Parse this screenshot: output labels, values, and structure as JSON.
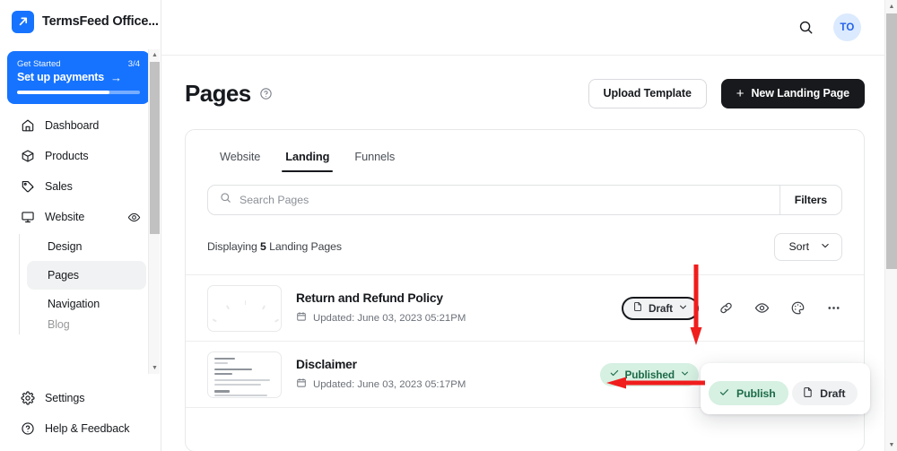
{
  "sidebar": {
    "brand": {
      "name": "TermsFeed Office...",
      "logo_icon": "app-logo-icon",
      "logo_color": "#1673ff"
    },
    "get_started": {
      "label": "Get Started",
      "count": "3/4",
      "action": "Set up payments",
      "arrow": "→",
      "progress_percent": 75,
      "color": "#1673ff"
    },
    "items": [
      {
        "label": "Dashboard",
        "icon": "home-icon"
      },
      {
        "label": "Products",
        "icon": "box-icon"
      },
      {
        "label": "Sales",
        "icon": "tag-icon"
      },
      {
        "label": "Website",
        "icon": "monitor-icon",
        "trailing_icon": "eye-icon"
      }
    ],
    "sub_items": [
      {
        "label": "Design",
        "active": false
      },
      {
        "label": "Pages",
        "active": true
      },
      {
        "label": "Navigation",
        "active": false
      },
      {
        "label": "Blog",
        "active": false
      }
    ],
    "bottom_items": [
      {
        "label": "Settings",
        "icon": "gear-icon"
      },
      {
        "label": "Help & Feedback",
        "icon": "question-circle-icon"
      }
    ]
  },
  "topbar": {
    "search_icon": "search-icon",
    "avatar_initials": "TO",
    "avatar_bg": "#dbeafe",
    "avatar_fg": "#2563eb"
  },
  "page": {
    "title": "Pages",
    "help_icon": "question-circle-icon",
    "upload_template_label": "Upload Template",
    "new_page_label": "New Landing Page",
    "new_page_plus": "+"
  },
  "tabs": [
    {
      "label": "Website",
      "active": false
    },
    {
      "label": "Landing",
      "active": true
    },
    {
      "label": "Funnels",
      "active": false
    }
  ],
  "search": {
    "placeholder": "Search Pages",
    "value": "",
    "icon": "search-icon"
  },
  "filters": {
    "label": "Filters"
  },
  "meta": {
    "displaying_prefix": "Displaying ",
    "count": "5",
    "displaying_suffix": " Landing Pages",
    "sort_label": "Sort",
    "sort_icon": "chevron-down-icon"
  },
  "rows": [
    {
      "title": "Return and Refund Policy",
      "updated": "Updated: June 03, 2023 05:21PM",
      "calendar_icon": "calendar-icon",
      "thumbnail": "loading-spinner",
      "status": "Draft",
      "status_kind": "draft",
      "status_icon": "document-icon",
      "status_chevron": "chevron-down-icon",
      "actions": [
        "link-icon",
        "eye-icon",
        "palette-icon",
        "more-horizontal-icon"
      ]
    },
    {
      "title": "Disclaimer",
      "updated": "Updated: June 03, 2023 05:17PM",
      "calendar_icon": "calendar-icon",
      "thumbnail": "document-preview",
      "status": "Published",
      "status_kind": "published",
      "status_icon": "check-icon",
      "status_chevron": "chevron-down-icon",
      "actions": [
        "link-icon",
        "eye-icon",
        "palette-icon",
        "more-horizontal-icon"
      ]
    }
  ],
  "dropdown": {
    "items": [
      {
        "label": "Publish",
        "icon": "check-icon",
        "kind": "publish"
      },
      {
        "label": "Draft",
        "icon": "document-icon",
        "kind": "draft"
      }
    ]
  },
  "annotations": {
    "color": "#f01d1d",
    "arrow_down": "points-to-draft-status-button",
    "arrow_left": "points-to-publish-menu-item"
  },
  "colors": {
    "brand_blue": "#1673ff",
    "dark_button": "#17191c",
    "published_green_bg": "#d6f0e2",
    "published_green_fg": "#1d6b48",
    "annotation_red": "#f01d1d"
  }
}
